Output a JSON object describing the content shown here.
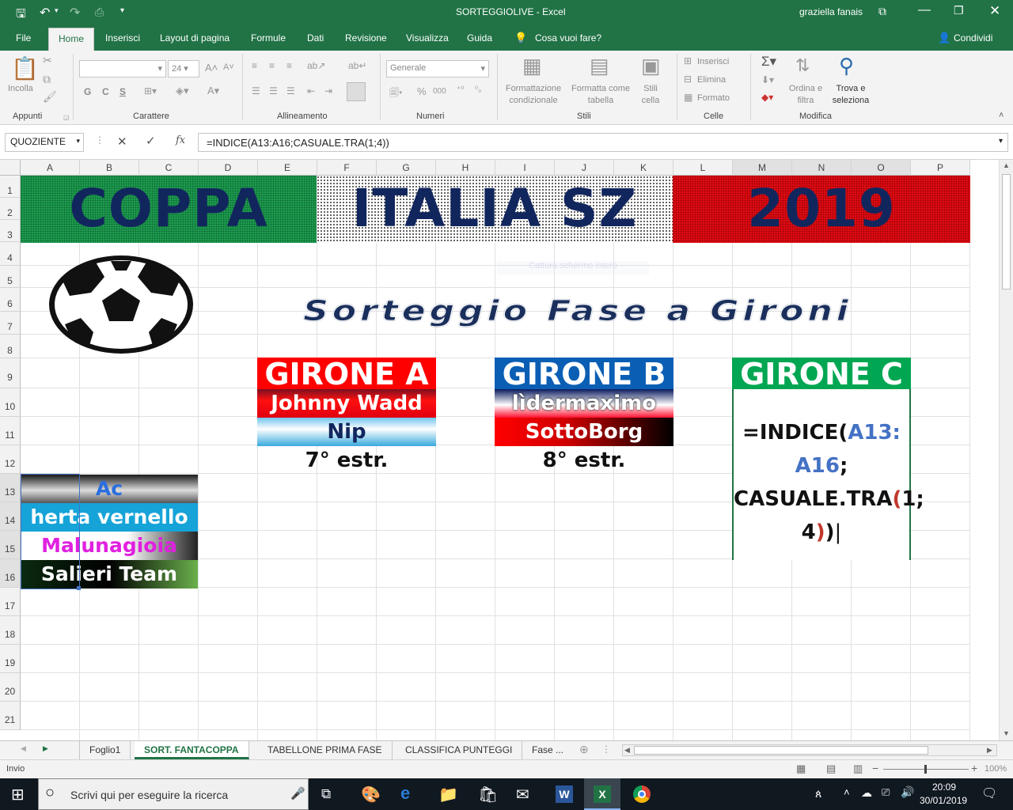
{
  "window": {
    "title": "SORTEGGIOLIVE  -  Excel",
    "user": "graziella fanais",
    "qat_dropdown": "▾"
  },
  "ribbon_tabs": [
    "File",
    "Home",
    "Inserisci",
    "Layout di pagina",
    "Formule",
    "Dati",
    "Revisione",
    "Visualizza",
    "Guida"
  ],
  "tell_me": "Cosa vuoi fare?",
  "share": "Condividi",
  "ribbon": {
    "paste": "Incolla",
    "font_size": "24",
    "bold": "G",
    "italic": "C",
    "underline": "S",
    "number_format": "Generale",
    "cond_format": "Formattazione condizionale",
    "format_table": "Formatta come tabella",
    "cell_styles": "Stili cella",
    "insert": "Inserisci",
    "delete": "Elimina",
    "format": "Formato",
    "sort_filter": "Ordina e filtra",
    "find_select": "Trova e seleziona",
    "groups": [
      "Appunti",
      "Carattere",
      "Allineamento",
      "Numeri",
      "Stili",
      "Celle",
      "Modifica"
    ]
  },
  "formula_bar": {
    "name_box": "QUOZIENTE",
    "fx": "fx",
    "formula": "=INDICE(A13:A16;CASUALE.TRA(1;4))"
  },
  "columns": [
    "A",
    "B",
    "C",
    "D",
    "E",
    "F",
    "G",
    "H",
    "I",
    "J",
    "K",
    "L",
    "M",
    "N",
    "O",
    "P"
  ],
  "rows": [
    "1",
    "2",
    "3",
    "4",
    "5",
    "6",
    "7",
    "8",
    "9",
    "10",
    "11",
    "12",
    "13",
    "14",
    "15",
    "16",
    "17",
    "18",
    "19",
    "20",
    "21"
  ],
  "sheet": {
    "title_left": "COPPA",
    "title_mid": "ITALIA SZ",
    "title_right": "2019",
    "subtitle": "Sorteggio Fase a Gironi",
    "ghost_text": "Cattura schermo intero",
    "girone_a": {
      "header": "GIRONE A",
      "teams": [
        "Johnny Wadd",
        "Nip"
      ],
      "next": "7° estr."
    },
    "girone_b": {
      "header": "GIRONE B",
      "teams": [
        "lìdermaximo",
        "SottoBorg"
      ],
      "next": "8° estr."
    },
    "girone_c": {
      "header": "GIRONE C",
      "edit_parts": {
        "p1": "=INDICE(",
        "p2": "A13:",
        "p3": "A16",
        ";": ";",
        "p4": "CASUALE.TRA",
        "p5": "(",
        "p6": "1;",
        "p7": "4",
        "p8": ")",
        ")": ")"
      }
    },
    "pool": [
      "Ac Hafnarfjarðar",
      "herta vernello",
      "Malunagioia",
      "Salieri Team"
    ]
  },
  "sheet_tabs": [
    "Foglio1",
    "SORT. FANTACOPPA",
    "TABELLONE PRIMA FASE",
    "CLASSIFICA PUNTEGGI",
    "Fase ..."
  ],
  "status": {
    "mode": "Invio",
    "zoom": "100%"
  },
  "taskbar": {
    "search_placeholder": "Scrivi qui per eseguire la ricerca",
    "time": "20:09",
    "date": "30/01/2019"
  },
  "colors": {
    "excel_green": "#217346",
    "banner_text": "#12265e",
    "girone_a": "#ff0000",
    "girone_b": "#0a5fb4",
    "girone_c": "#00a651"
  }
}
